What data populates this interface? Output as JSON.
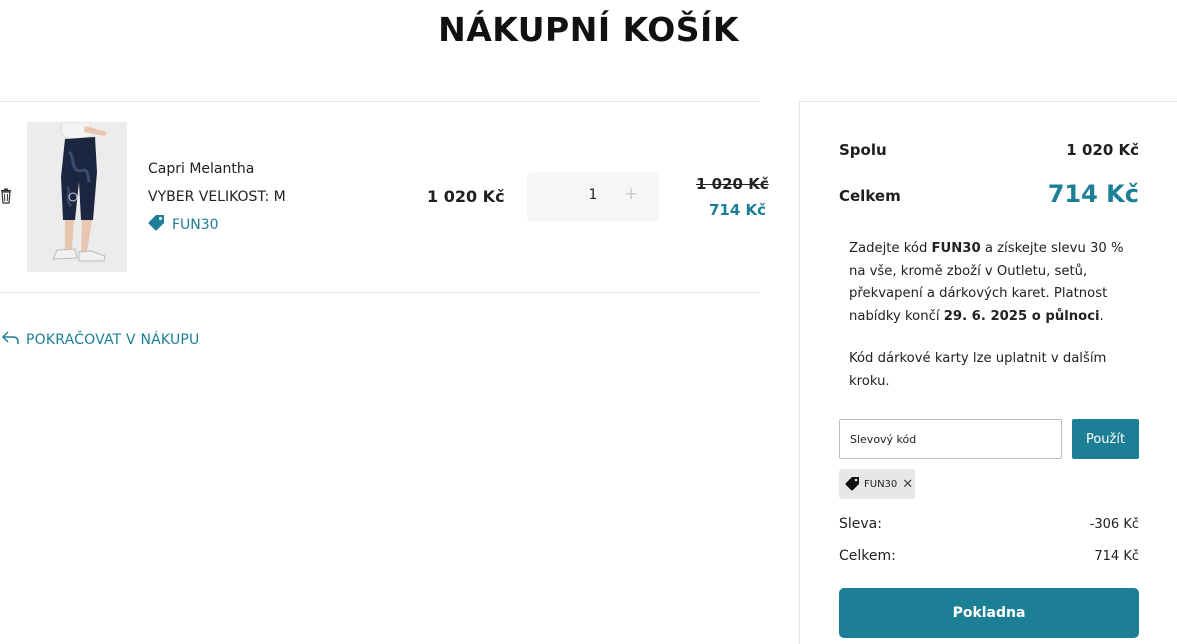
{
  "page": {
    "title": "NÁKUPNÍ KOŠÍK"
  },
  "cart": {
    "item": {
      "name": "Capri Melantha",
      "size_label": "VYBER VELIKOST: M",
      "discount_code": "FUN30",
      "unit_price": "1 020 Kč",
      "quantity": "1",
      "old_price": "1 020 Kč",
      "new_price": "714 Kč",
      "image_icon": "product-photo"
    },
    "continue_label": "POKRAČOVAT V NÁKUPU",
    "continue_icon": "return-arrow-icon",
    "remove_icon": "trash-icon"
  },
  "summary": {
    "subtotal_label": "Spolu",
    "subtotal_value": "1 020 Kč",
    "total_label": "Celkem",
    "total_value": "714 Kč",
    "promo": {
      "part1": "Zadejte kód ",
      "code": "FUN30",
      "part2": " a získejte slevu 30 % na vše, kromě zboží v Outletu, setů, překvapení a dárkových karet. Platnost nabídky končí ",
      "deadline": "29. 6. 2025 o půlnoci",
      "part3": "."
    },
    "gift_text": "Kód dárkové karty lze uplatnit v dalším kroku.",
    "code_input_placeholder": "Slevový kód",
    "apply_label": "Použít",
    "applied_code": "FUN30",
    "discount_label": "Sleva:",
    "discount_value": "-306 Kč",
    "final_label": "Celkem:",
    "final_value": "714 Kč",
    "checkout_label": "Pokladna"
  },
  "colors": {
    "accent": "#1c7f96",
    "chip_bg": "#e7e7e7"
  }
}
